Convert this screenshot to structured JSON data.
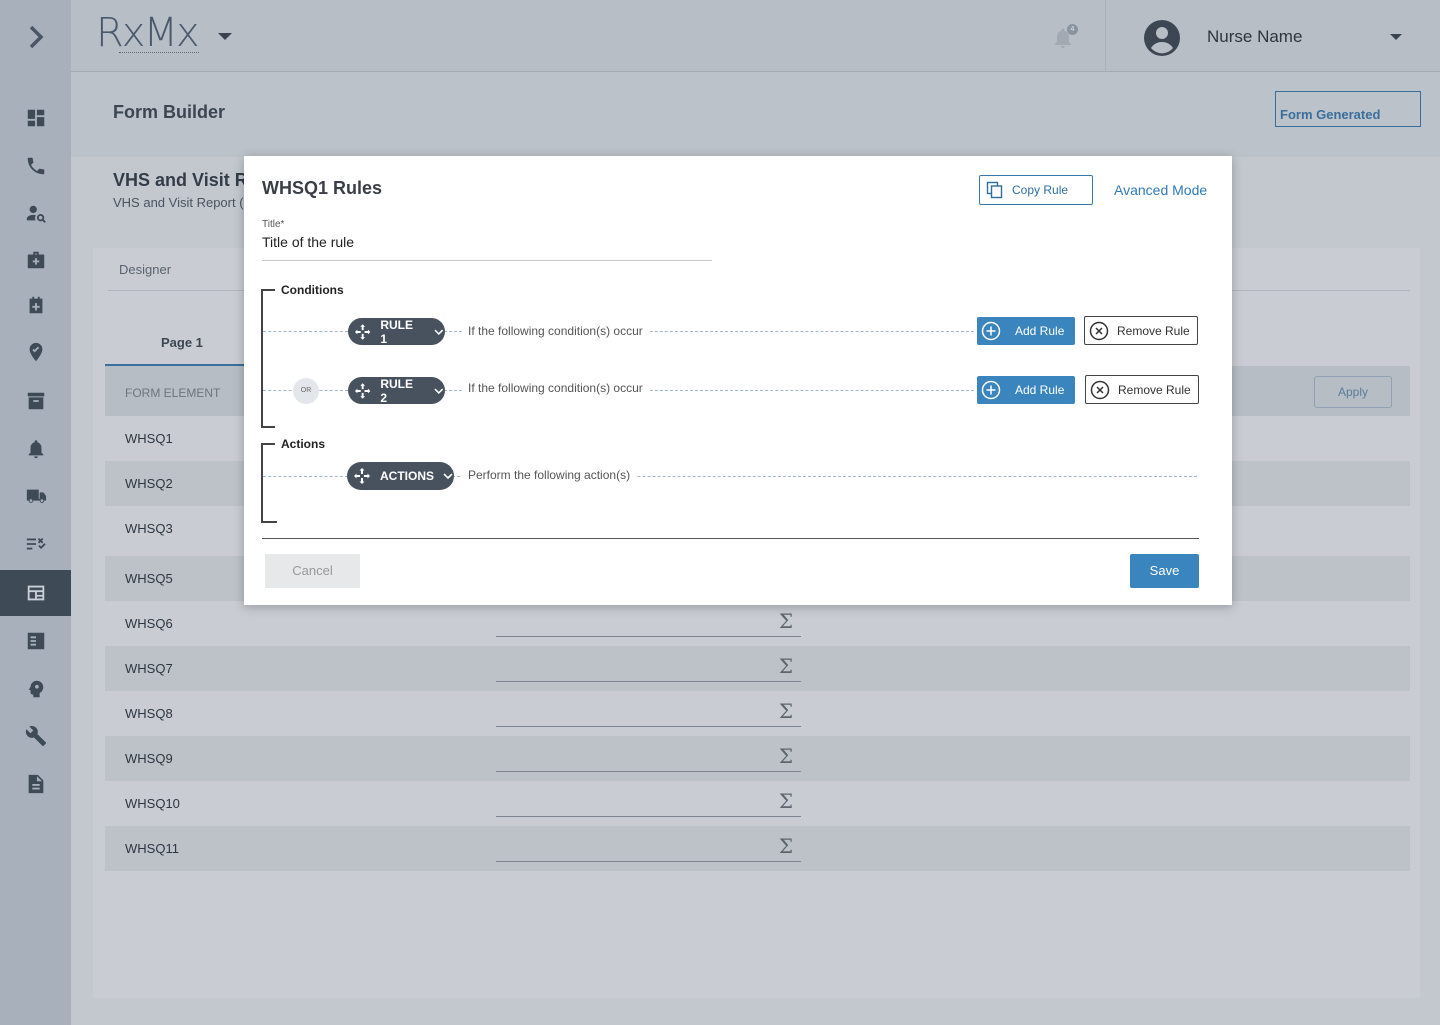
{
  "header": {
    "logo_text": "RxMx",
    "notification_count": "4",
    "user_name": "Nurse Name"
  },
  "page": {
    "title": "Form Builder",
    "form_generated_label": "Form Generated"
  },
  "section": {
    "title": "VHS and Visit Re",
    "subtitle": "VHS and Visit Report (I",
    "designer_tab": "Designer",
    "page_tab": "Page 1",
    "form_element_header": "FORM ELEMENT",
    "apply_label": "Apply"
  },
  "rows": [
    "WHSQ1",
    "WHSQ2",
    "WHSQ3",
    "WHSQ5",
    "WHSQ6",
    "WHSQ7",
    "WHSQ8",
    "WHSQ9",
    "WHSQ10",
    "WHSQ11"
  ],
  "modal": {
    "title": "WHSQ1 Rules",
    "copy_rule_label": "Copy Rule",
    "advanced_mode_label": "Avanced Mode",
    "title_field_label": "Title*",
    "title_field_value": "Title of the rule",
    "conditions_label": "Conditions",
    "actions_label": "Actions",
    "rule1_label": "RULE 1",
    "rule2_label": "RULE 2",
    "or_label": "OR",
    "condition_text": "If the following condition(s) occur",
    "actions_pill_label": "ACTIONS",
    "actions_text": "Perform the following action(s)",
    "add_rule_label": "Add Rule",
    "remove_rule_label": "Remove Rule",
    "cancel_label": "Cancel",
    "save_label": "Save"
  },
  "icons": {
    "sidebar": [
      "chevron-right-icon",
      "dashboard-icon",
      "phone-icon",
      "person-search-icon",
      "medical-bag-icon",
      "add-calendar-icon",
      "location-pin-icon",
      "archive-icon",
      "bell-icon",
      "truck-icon",
      "checklist-icon",
      "form-icon",
      "task-list-icon",
      "brain-gear-icon",
      "wrench-icon",
      "document-icon"
    ]
  },
  "colors": {
    "accent": "#3a85bd",
    "sidebar_active": "#3f4a57",
    "pill": "#48525e"
  }
}
